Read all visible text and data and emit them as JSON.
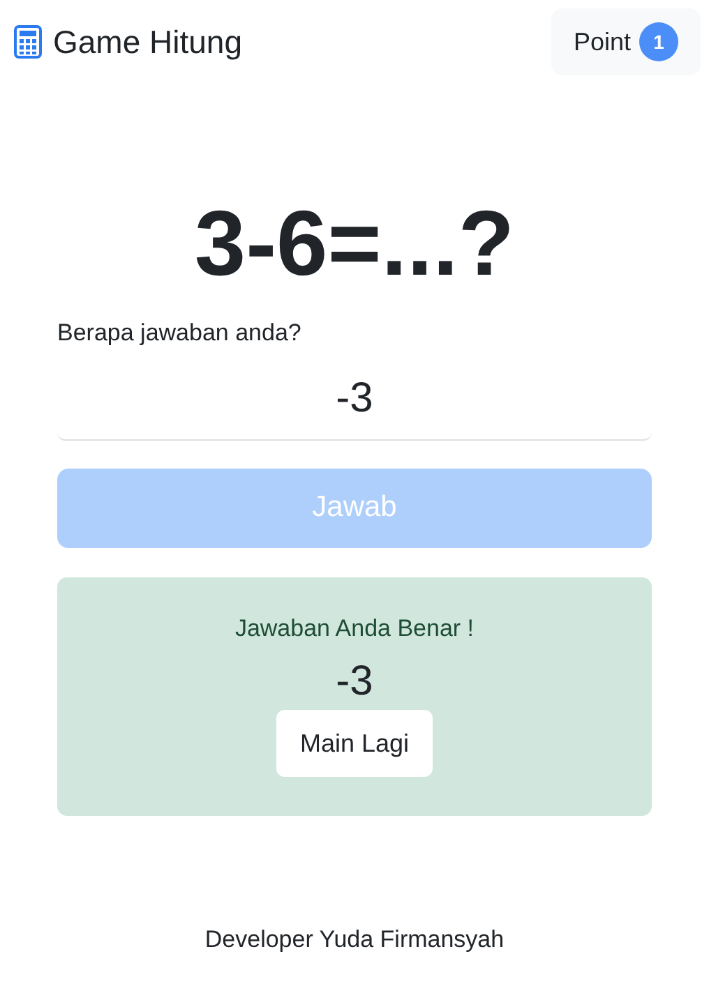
{
  "navbar": {
    "title": "Game Hitung",
    "point_label": "Point",
    "point_count": "1"
  },
  "question": "3-6=...?",
  "answer_field": {
    "label": "Berapa jawaban anda?",
    "value": "-3"
  },
  "submit_button": {
    "label": "Jawab",
    "disabled": true
  },
  "result": {
    "message": "Jawaban Anda Benar !",
    "answer": "-3",
    "button": "Main Lagi"
  },
  "footer": "Developer Yuda Firmansyah"
}
